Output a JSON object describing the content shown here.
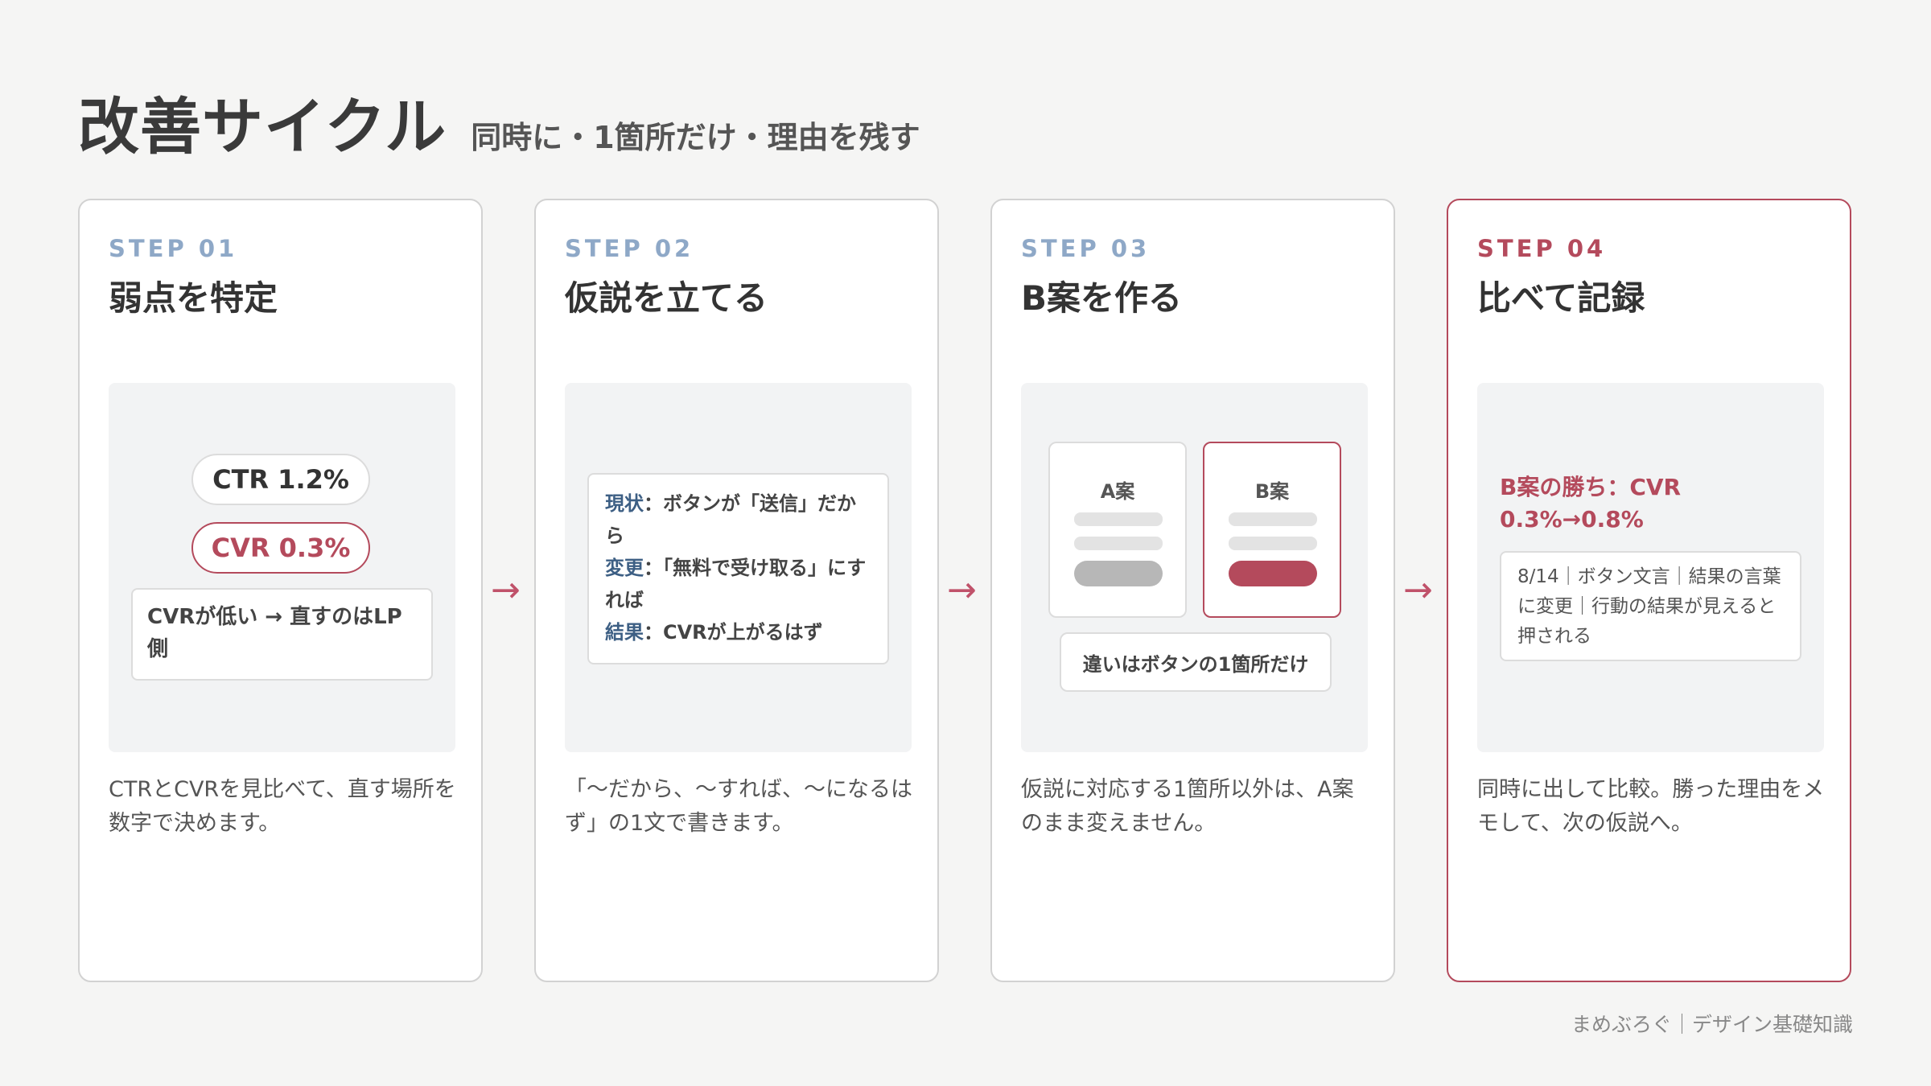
{
  "header": {
    "title": "改善サイクル",
    "subtitle": "同時に・1箇所だけ・理由を残す"
  },
  "steps": [
    {
      "label": "STEP 01",
      "title": "弱点を特定",
      "ctr": "CTR 1.2%",
      "cvr": "CVR 0.3%",
      "note": "CVRが低い → 直すのはLP側",
      "desc": "CTRとCVRを見比べて、直す場所を数字で決めます。"
    },
    {
      "label": "STEP 02",
      "title": "仮説を立てる",
      "current_key": "現状",
      "current_val": "：ボタンが「送信」だから",
      "change_key": "変更",
      "change_val": "：「無料で受け取る」にすれば",
      "result_key": "結果",
      "result_val": "：CVRが上がるはず",
      "desc": "「〜だから、〜すれば、〜になるはず」の1文で書きます。"
    },
    {
      "label": "STEP 03",
      "title": "B案を作る",
      "a_label": "A案",
      "b_label": "B案",
      "diff": "違いはボタンの1箇所だけ",
      "desc": "仮説に対応する1箇所以外は、A案のまま変えません。"
    },
    {
      "label": "STEP 04",
      "title": "比べて記録",
      "win": "B案の勝ち：CVR 0.3%→0.8%",
      "memo": "8/14｜ボタン文言｜結果の言葉に変更｜行動の結果が見えると押される",
      "desc": "同時に出して比較。勝った理由をメモして、次の仮説へ。"
    }
  ],
  "arrow": "→",
  "footer": "まめぶろぐ｜デザイン基礎知識",
  "colors": {
    "accent": "#b44a5c",
    "step_blue": "#8ea8c7",
    "key_blue": "#3d5f84",
    "background": "#f5f5f4"
  }
}
